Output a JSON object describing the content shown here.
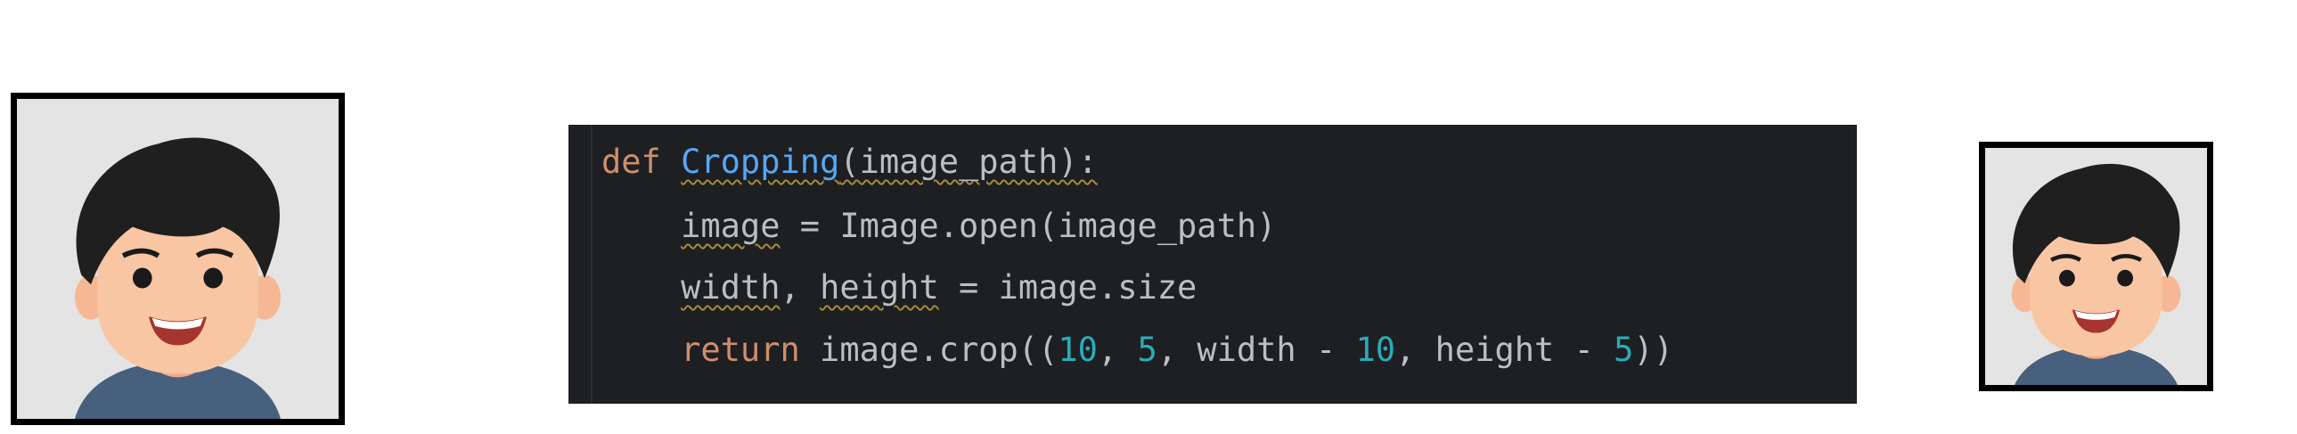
{
  "images": {
    "original": {
      "name": "original-avatar-image"
    },
    "cropped": {
      "name": "cropped-avatar-image"
    }
  },
  "code": {
    "lines": [
      {
        "tokens": [
          {
            "text": "def",
            "kind": "kw"
          },
          {
            "text": " ",
            "kind": "plain"
          },
          {
            "text": "Cropping",
            "kind": "fn-warn"
          },
          {
            "text": "(image_path):",
            "kind": "plain-warn"
          }
        ]
      },
      {
        "tokens": [
          {
            "text": "    ",
            "kind": "plain"
          },
          {
            "text": "image",
            "kind": "plain-warn"
          },
          {
            "text": " = Image.open(image_path)",
            "kind": "plain"
          }
        ]
      },
      {
        "tokens": [
          {
            "text": "    ",
            "kind": "plain"
          },
          {
            "text": "width",
            "kind": "plain-warn"
          },
          {
            "text": ", ",
            "kind": "plain"
          },
          {
            "text": "height",
            "kind": "plain-warn"
          },
          {
            "text": " = image.size",
            "kind": "plain"
          }
        ]
      },
      {
        "tokens": [
          {
            "text": "    ",
            "kind": "plain"
          },
          {
            "text": "return",
            "kind": "kw"
          },
          {
            "text": " image.crop((",
            "kind": "plain"
          },
          {
            "text": "10",
            "kind": "num"
          },
          {
            "text": ", ",
            "kind": "plain"
          },
          {
            "text": "5",
            "kind": "num"
          },
          {
            "text": ", width - ",
            "kind": "plain"
          },
          {
            "text": "10",
            "kind": "num"
          },
          {
            "text": ", height - ",
            "kind": "plain"
          },
          {
            "text": "5",
            "kind": "num"
          },
          {
            "text": "))",
            "kind": "plain"
          }
        ]
      }
    ],
    "colors": {
      "background": "#1e1f22",
      "text": "#bcbec4",
      "keyword": "#cf8e6d",
      "function": "#56a8f5",
      "number": "#2aacb8",
      "warning_underline": "#a68a3b"
    }
  }
}
